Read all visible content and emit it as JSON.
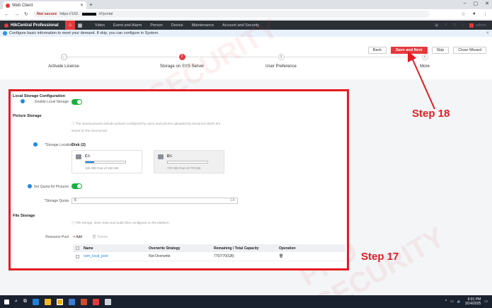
{
  "browser": {
    "tab_title": "Web Client",
    "new_tab": "+",
    "not_secure": "Not secure",
    "url_prefix": "https://192.",
    "url_suffix": "/#/portal"
  },
  "app": {
    "name": "HikCentral Professional",
    "nav": [
      "Video",
      "Event and Alarm",
      "Person",
      "Device",
      "Maintenance",
      "Account and Security"
    ],
    "user": "admin"
  },
  "info_bar": {
    "text": "Configure basic information to meet your demand. If skip, you can configure in System."
  },
  "wizard": {
    "steps": [
      {
        "label": "Activate License",
        "number": "✓",
        "state": "done"
      },
      {
        "label": "Storage on SYS Server",
        "number": "2",
        "state": "active"
      },
      {
        "label": "User Preference",
        "number": "3",
        "state": "todo"
      },
      {
        "label": "More",
        "number": "4",
        "state": "todo"
      }
    ],
    "buttons": {
      "back": "Back",
      "save_next": "Save and Next",
      "skip": "Skip",
      "close": "Close Wizard"
    }
  },
  "local_storage": {
    "section_title": "Local Storage Configuration",
    "enable_label": "Enable Local Storage",
    "enabled": true
  },
  "picture_storage": {
    "section_title": "Picture Storage",
    "hint_line1": "The stored pictures include pictures configured by users and pictures uploaded by resources which are",
    "hint_line2": "stored on the local server.",
    "location_label": "*Storage Location",
    "disk_header": "Disk (2)",
    "disks": [
      {
        "name": "C:\\",
        "free_text": "125 GB Free of 160 GB",
        "used_fraction": 0.22
      },
      {
        "name": "D:\\",
        "free_text": "770 GB Free of 770 GB",
        "used_fraction": 0.0
      }
    ],
    "quota_label": "Set Quota for Pictures",
    "quota_enabled": true,
    "storage_quota_label": "*Storage Quota",
    "storage_quota_value": "5",
    "storage_quota_unit": "GB"
  },
  "file_storage": {
    "section_title": "File Storage",
    "hint": "File storage: store video and audio files configured on the platform.",
    "resource_pool_label": "Resource Pool",
    "add_label": "Add",
    "delete_label": "Delete",
    "table": {
      "headers": [
        "Name",
        "Overwrite Strategy",
        "Remaining / Total Capacity",
        "Operation"
      ],
      "rows": [
        {
          "name": "vsm_local_pool",
          "overwrite": "Not Overwrite",
          "capacity": "770/770(GB)"
        }
      ]
    }
  },
  "callouts": {
    "step18": "Step 18",
    "step17": "Step 17"
  },
  "watermark": "PRO SECURITY",
  "taskbar": {
    "time": "6:01 PM",
    "date": "3/14/2025"
  },
  "colors": {
    "accent": "#e4393c",
    "callout": "#e31b23",
    "toggle_on": "#1aae3e",
    "link": "#1e88e5"
  }
}
